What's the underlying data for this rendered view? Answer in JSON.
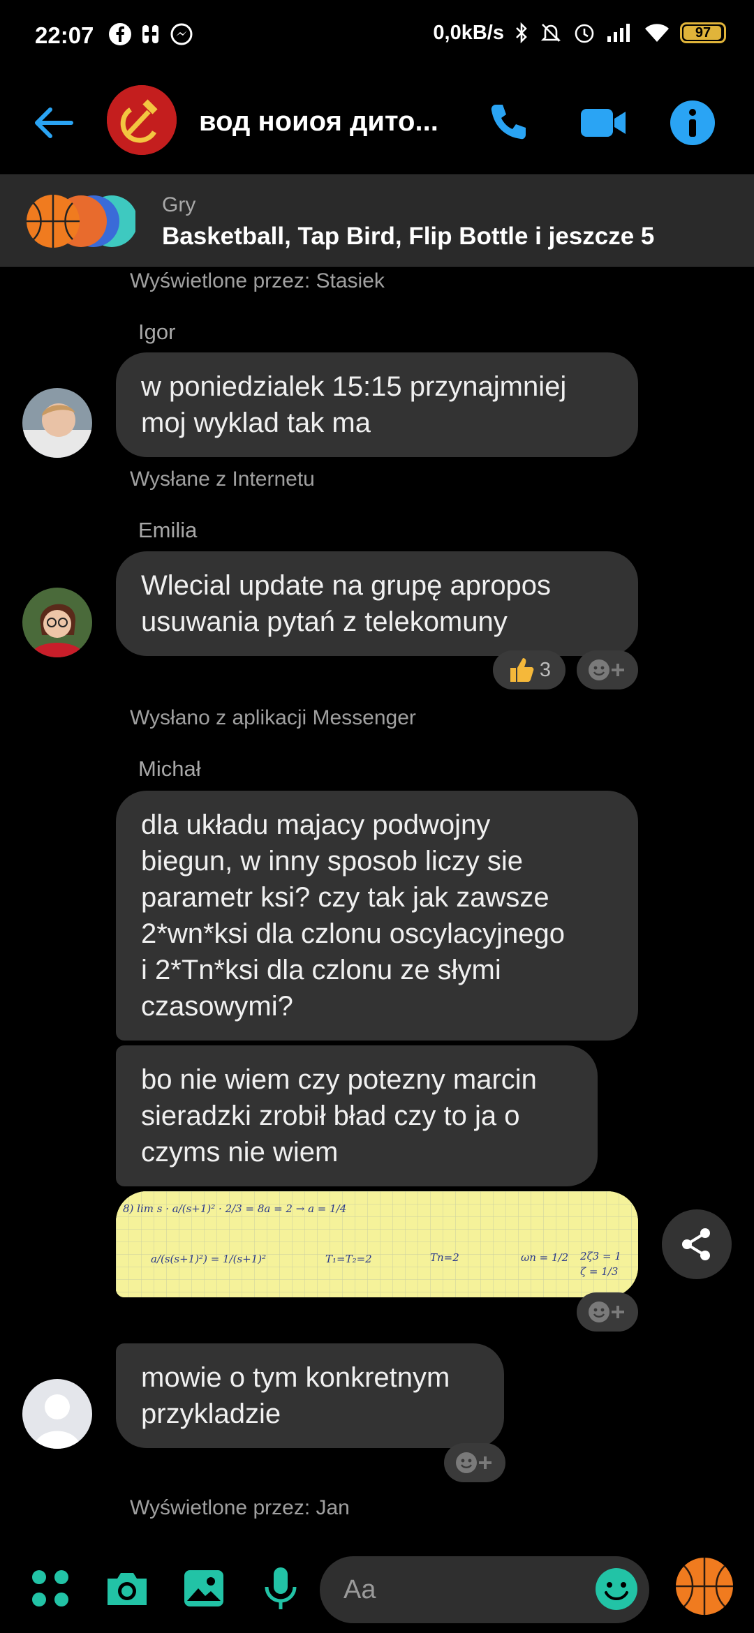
{
  "status_bar": {
    "time": "22:07",
    "net_speed": "0,0kB/s",
    "battery": "97",
    "battery_level": 0.97
  },
  "header": {
    "title": "вод ноиоя дито...",
    "accent_color": "#2aa4f4"
  },
  "games_banner": {
    "label": "Gry",
    "games": "Basketball, Tap Bird, Flip Bottle i jeszcze 5"
  },
  "messages": {
    "seen_top": "Wyświetlone przez: Stasiek",
    "m1": {
      "sender": "Igor",
      "text_line1": "w poniedzialek 15:15 przynajmniej",
      "text_line2": "moj wyklad tak ma",
      "footer": "Wysłane z Internetu"
    },
    "m2": {
      "sender": "Emilia",
      "text_line1": "Wlecial update na grupę apropos",
      "text_line2": "usuwania pytań z telekomuny",
      "reaction_count": "3",
      "reaction_icon": "thumbs-up-icon",
      "footer": "Wysłano z aplikacji Messenger"
    },
    "m3": {
      "sender": "Michał",
      "bubble1_lines": [
        "dla układu majacy podwojny",
        "biegun, w inny sposob liczy sie",
        "parametr ksi? czy tak jak zawsze",
        "2*wn*ksi dla czlonu oscylacyjnego",
        "i 2*Tn*ksi dla czlonu ze słymi",
        "czasowymi?"
      ],
      "bubble2_lines": [
        "bo nie wiem czy potezny marcin",
        "sieradzki zrobił bład czy to ja o",
        "czyms nie wiem"
      ],
      "image_note": {
        "line1": "8) lim s · a/(s+1)² · 2/3 = 8a = 2 → a = 1/4",
        "line2": "a/(s(s+1)²) = 1/(s+1)²",
        "t1": "T₁=T₂=2",
        "t2": "Tn=2",
        "w": "ωn = 1/2",
        "z": "2ζ3 = 1",
        "z2": "ζ = 1/3"
      }
    },
    "m4": {
      "text_line1": "mowie o tym konkretnym",
      "text_line2": "przykladzie"
    },
    "seen_bottom": "Wyświetlone przez: Jan"
  },
  "composer": {
    "placeholder": "Aa",
    "accent_color": "#22c3a6"
  }
}
